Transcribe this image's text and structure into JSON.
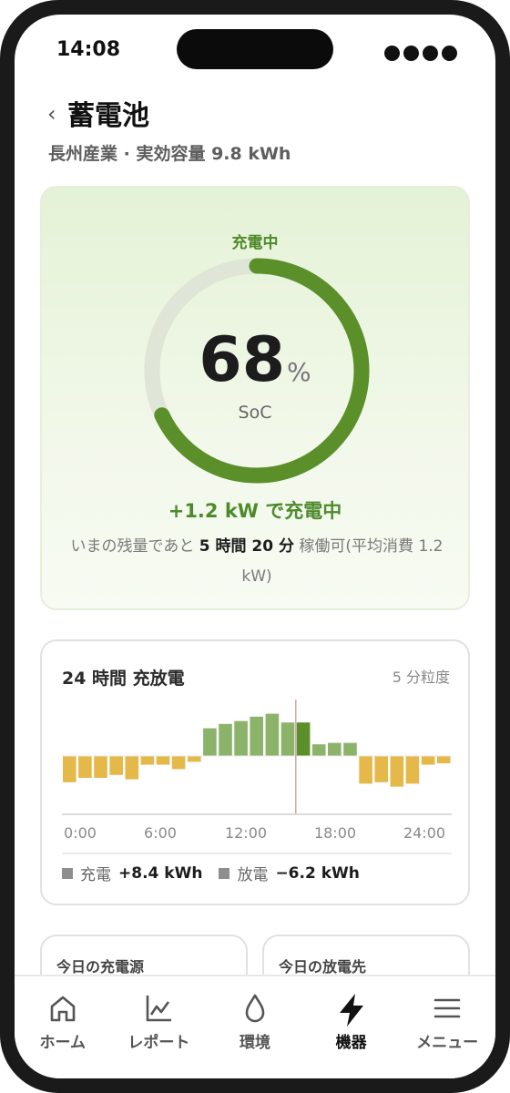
{
  "status_bar": {
    "time": "14:08"
  },
  "header": {
    "back": "‹",
    "title": "蓄電池",
    "subtitle": "長州産業 · 実効容量 9.8 kWh"
  },
  "battery": {
    "status": "充電中",
    "soc_value": 68,
    "soc_display": "68",
    "soc_unit": "%",
    "soc_label": "SoC",
    "rate_text": "+1.2 kW で充電中",
    "remain_prefix": "いまの残量であと ",
    "remain_time": "5 時間 20 分",
    "remain_suffix": " 稼働可(平均消費 1.2 kW)",
    "colors": {
      "arc": "#5a8f2a",
      "track": "#dfe5d7"
    }
  },
  "chart_card": {
    "title": "24 時間 充放電",
    "granularity": "5 分粒度",
    "legend": {
      "charge_label": "充電",
      "charge_value": "+8.4 kWh",
      "discharge_label": "放電",
      "discharge_value": "−6.2 kWh"
    }
  },
  "chart_data": {
    "type": "bar",
    "x_tick_labels": [
      "0:00",
      "6:00",
      "12:00",
      "18:00",
      "24:00"
    ],
    "xlim": [
      0,
      24
    ],
    "values": [
      -1.8,
      -1.5,
      -1.5,
      -1.3,
      -1.6,
      -0.6,
      -0.6,
      -0.9,
      -0.4,
      1.9,
      2.2,
      2.4,
      2.7,
      2.9,
      2.3,
      2.3,
      0.8,
      0.9,
      0.9,
      -1.9,
      -1.8,
      -2.1,
      -1.9,
      -0.6,
      -0.5
    ],
    "current_hour": 14.4,
    "colors": {
      "charge": "#8cb36a",
      "charge_current": "#5a8f2a",
      "discharge": "#e5b84a",
      "now_line": "#c9a39e"
    }
  },
  "mini_cards": {
    "charge_source": "今日の充電源",
    "discharge_target": "今日の放電先"
  },
  "nav": {
    "items": [
      {
        "label": "ホーム",
        "icon": "home-icon"
      },
      {
        "label": "レポート",
        "icon": "chart-icon"
      },
      {
        "label": "環境",
        "icon": "drop-icon"
      },
      {
        "label": "機器",
        "icon": "bolt-icon"
      },
      {
        "label": "メニュー",
        "icon": "menu-icon"
      }
    ]
  }
}
